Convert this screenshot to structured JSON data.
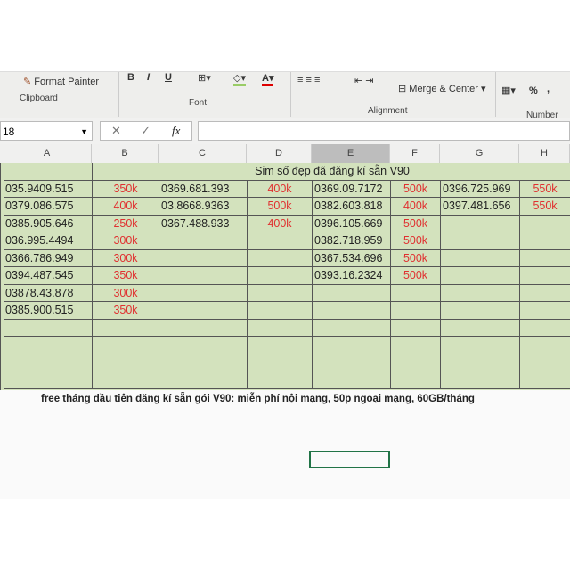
{
  "ribbon": {
    "format_painter": "Format Painter",
    "bold": "B",
    "italic": "I",
    "underline": "U",
    "merge_center": "Merge & Center",
    "percent": "%",
    "comma": ",",
    "groups": {
      "clipboard": "Clipboard",
      "font": "Font",
      "alignment": "Alignment",
      "number": "Number"
    }
  },
  "formula_bar": {
    "name_box": "18",
    "cancel": "✕",
    "enter": "✓",
    "fx": "fx",
    "value": ""
  },
  "columns": [
    "A",
    "B",
    "C",
    "D",
    "E",
    "F",
    "G",
    "H"
  ],
  "sheet": {
    "title": "Sim số đẹp đã đăng kí sẵn V90",
    "rows": [
      [
        "035.9409.515",
        "350k",
        "0369.681.393",
        "400k",
        "0369.09.7172",
        "500k",
        "0396.725.969",
        "550k"
      ],
      [
        "0379.086.575",
        "400k",
        "03.8668.9363",
        "500k",
        "0382.603.818",
        "400k",
        "0397.481.656",
        "550k"
      ],
      [
        "0385.905.646",
        "250k",
        "0367.488.933",
        "400k",
        "0396.105.669",
        "500k",
        "",
        ""
      ],
      [
        "036.995.4494",
        "300k",
        "",
        "",
        "0382.718.959",
        "500k",
        "",
        ""
      ],
      [
        "0366.786.949",
        "300k",
        "",
        "",
        "0367.534.696",
        "500k",
        "",
        ""
      ],
      [
        "0394.487.545",
        "350k",
        "",
        "",
        "0393.16.2324",
        "500k",
        "",
        ""
      ],
      [
        "03878.43.878",
        "300k",
        "",
        "",
        "",
        "",
        "",
        ""
      ],
      [
        "0385.900.515",
        "350k",
        "",
        "",
        "",
        "",
        "",
        ""
      ]
    ],
    "footer": "free tháng đầu tiên đăng kí sẵn gói V90: miễn phí nội mạng, 50p ngoại mạng, 60GB/tháng"
  },
  "colors": {
    "sheet_bg": "#d3e2bd",
    "price": "#e03030",
    "selection": "#217346"
  }
}
